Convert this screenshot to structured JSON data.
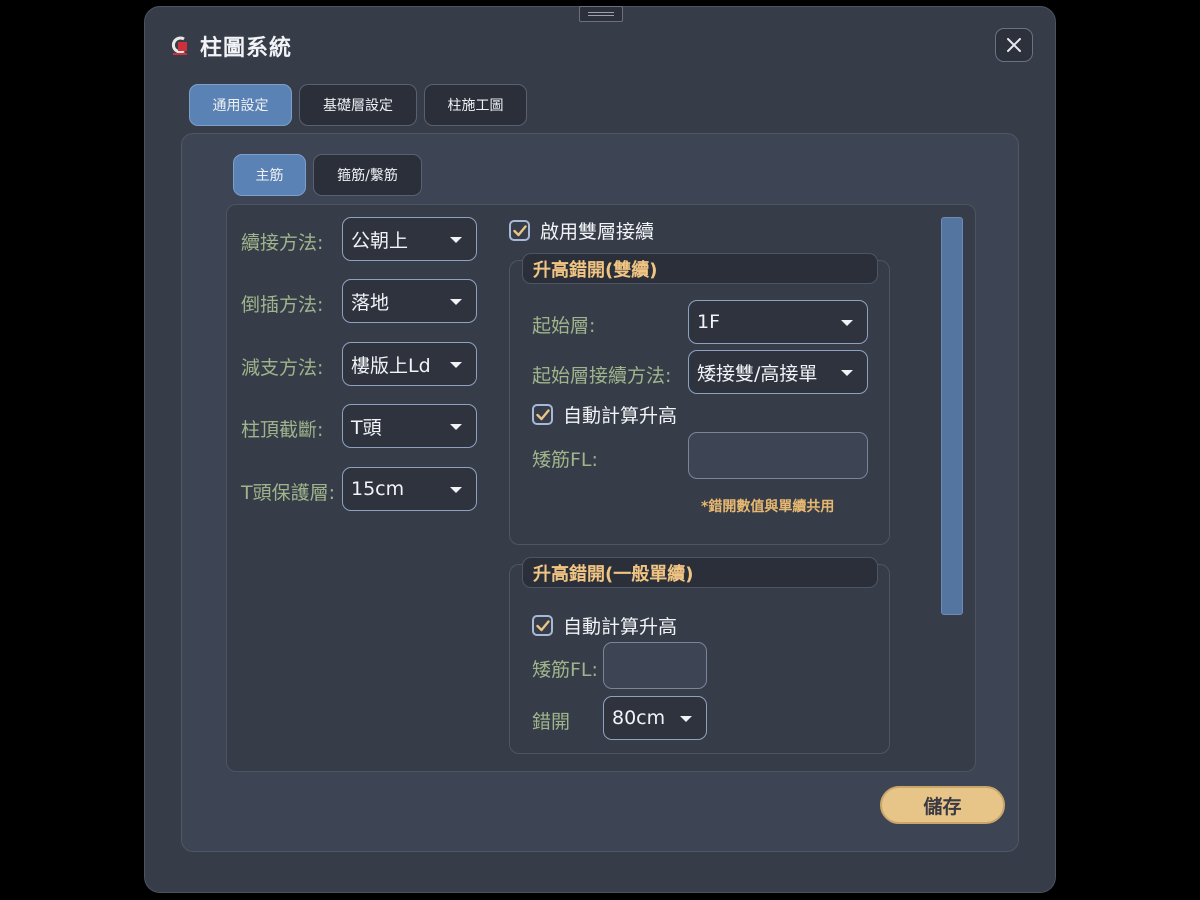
{
  "window": {
    "title": "柱圖系統",
    "close_icon": "close-icon",
    "logo_icon": "app-logo-icon"
  },
  "top_tabs": [
    {
      "label": "通用設定",
      "active": true
    },
    {
      "label": "基礎層設定",
      "active": false
    },
    {
      "label": "柱施工圖",
      "active": false
    }
  ],
  "sub_tabs": [
    {
      "label": "主筋",
      "active": true
    },
    {
      "label": "箍筋/繫筋",
      "active": false
    }
  ],
  "main_settings": {
    "splice_method": {
      "label": "續接方法:",
      "value": "公朝上"
    },
    "insert_method": {
      "label": "倒插方法:",
      "value": "落地"
    },
    "reduce_method": {
      "label": "減支方法:",
      "value": "樓版上Ld"
    },
    "top_cut": {
      "label": "柱頂截斷:",
      "value": "T頭"
    },
    "t_cover": {
      "label": "T頭保護層:",
      "value": "15cm"
    }
  },
  "double_splice": {
    "enable_label": "啟用雙層接續",
    "enabled": true,
    "title": "升高錯開(雙續)",
    "start_floor": {
      "label": "起始層:",
      "value": "1F"
    },
    "start_floor_method": {
      "label": "起始層接續方法:",
      "value": "矮接雙/高接單"
    },
    "auto_calc": {
      "label": "自動計算升高",
      "checked": true
    },
    "short_bar_fl": {
      "label": "矮筋FL:",
      "value": ""
    },
    "note": "*錯開數值與單續共用"
  },
  "single_splice": {
    "title": "升高錯開(一般單續)",
    "auto_calc": {
      "label": "自動計算升高",
      "checked": true
    },
    "short_bar_fl": {
      "label": "矮筋FL:",
      "value": ""
    },
    "offset": {
      "label": "錯開",
      "value": "80cm"
    }
  },
  "save_label": "儲存",
  "colors": {
    "accent": "#5b82b5",
    "label_green": "#9fb48c",
    "group_title": "#f0c583",
    "save_button": "#e7c487"
  }
}
